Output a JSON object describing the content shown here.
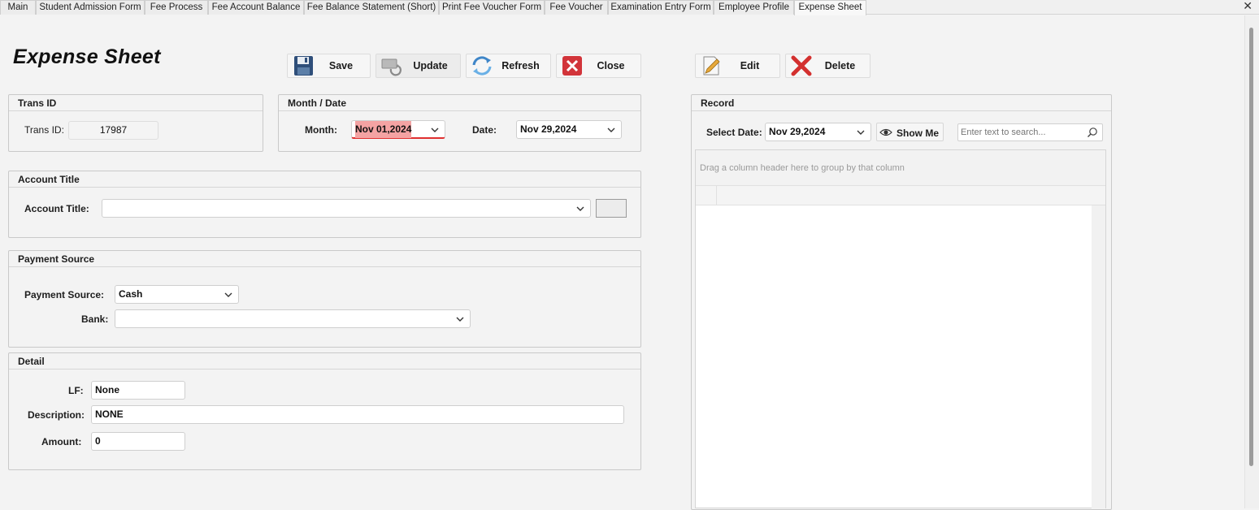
{
  "tabs": [
    {
      "label": "Main"
    },
    {
      "label": "Student Admission Form"
    },
    {
      "label": "Fee Process"
    },
    {
      "label": "Fee Account Balance"
    },
    {
      "label": "Fee Balance Statement (Short)"
    },
    {
      "label": "Print Fee Voucher Form"
    },
    {
      "label": "Fee Voucher"
    },
    {
      "label": "Examination Entry Form"
    },
    {
      "label": "Employee Profile"
    },
    {
      "label": "Expense Sheet"
    }
  ],
  "tab_close": "✕",
  "page_title": "Expense Sheet",
  "toolbar": {
    "save": "Save",
    "update": "Update",
    "refresh": "Refresh",
    "close": "Close",
    "edit": "Edit",
    "delete": "Delete"
  },
  "trans": {
    "group_title": "Trans ID",
    "label": "Trans ID:",
    "value": "17987"
  },
  "month_date": {
    "group_title": "Month / Date",
    "month_label": "Month:",
    "month_value": "Nov 01,2024",
    "date_label": "Date:",
    "date_value": "Nov 29,2024"
  },
  "account": {
    "group_title": "Account Title",
    "label": "Account Title:",
    "value": ""
  },
  "payment": {
    "group_title": "Payment Source",
    "source_label": "Payment Source:",
    "source_value": "Cash",
    "bank_label": "Bank:",
    "bank_value": ""
  },
  "detail": {
    "group_title": "Detail",
    "lf_label": "LF:",
    "lf_value": "None",
    "description_label": "Description:",
    "description_value": "NONE",
    "amount_label": "Amount:",
    "amount_value": "0"
  },
  "record": {
    "group_title": "Record",
    "select_date_label": "Select Date:",
    "select_date_value": "Nov 29,2024",
    "show_me": "Show Me",
    "search_placeholder": "Enter text to search...",
    "group_panel_hint": "Drag a column header here to group by that column"
  },
  "colors": {
    "month_highlight": "#f4a3a3",
    "month_underline": "#e03030",
    "panel_bg": "#f3f3f3"
  }
}
